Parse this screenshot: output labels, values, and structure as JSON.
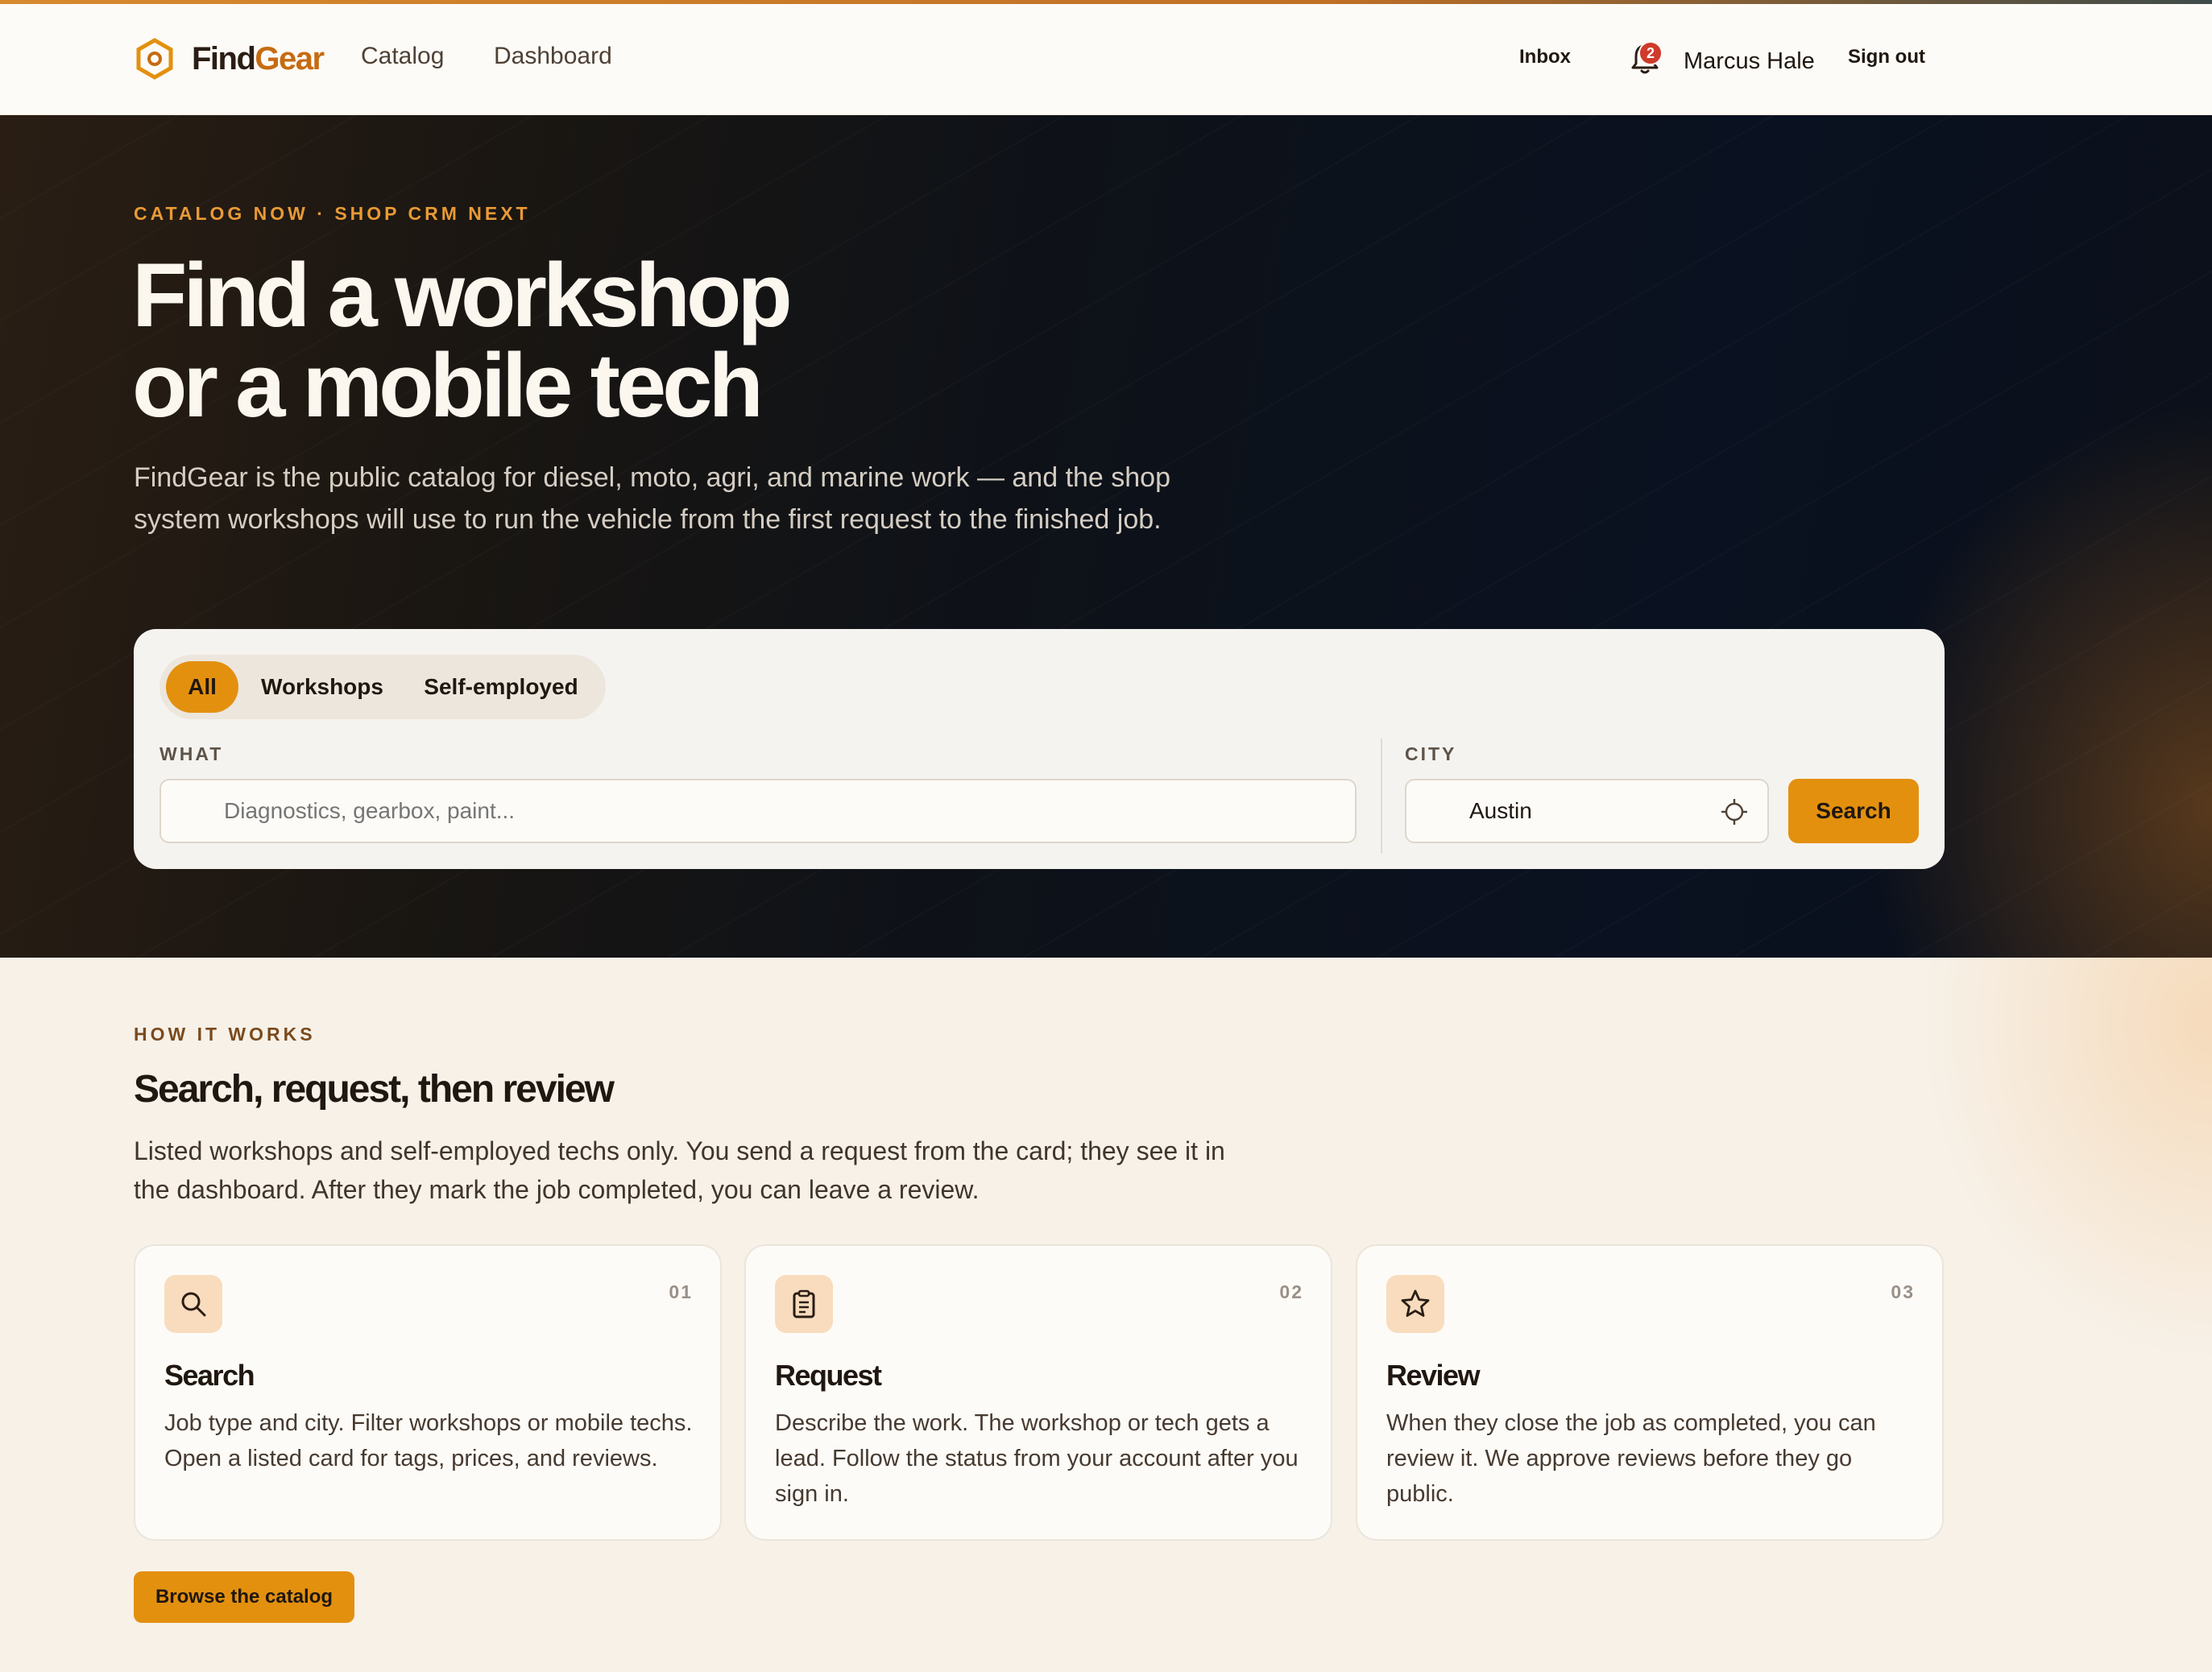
{
  "brand": {
    "name_part1": "Find",
    "name_part2": "Gear",
    "accent": "#e3900f",
    "brand_orange": "#c66b12"
  },
  "nav": {
    "links": [
      "Catalog",
      "Dashboard"
    ],
    "inbox": "Inbox",
    "notifications_count": "2",
    "user_name": "Marcus Hale",
    "sign_out": "Sign out"
  },
  "hero": {
    "eyebrow": "CATALOG NOW · SHOP CRM NEXT",
    "title_line1": "Find a workshop",
    "title_line2": "or a mobile tech",
    "description": "FindGear is the public catalog for diesel, moto, agri, and marine work — and the shop system workshops will use to run the vehicle from the first request to the finished job."
  },
  "search": {
    "tabs": [
      "All",
      "Workshops",
      "Self-employed"
    ],
    "active_tab": "All",
    "what_label": "WHAT",
    "what_placeholder": "Diagnostics, gearbox, paint...",
    "what_value": "",
    "city_label": "CITY",
    "city_value": "Austin",
    "button": "Search"
  },
  "how": {
    "eyebrow": "HOW IT WORKS",
    "title": "Search, request, then review",
    "description": "Listed workshops and self-employed techs only. You send a request from the card; they see it in the dashboard. After they mark the job completed, you can leave a review.",
    "cards": [
      {
        "num": "01",
        "icon": "search-icon",
        "title": "Search",
        "text": "Job type and city. Filter workshops or mobile techs. Open a listed card for tags, prices, and reviews."
      },
      {
        "num": "02",
        "icon": "clipboard-icon",
        "title": "Request",
        "text": "Describe the work. The workshop or tech gets a lead. Follow the status from your account after you sign in."
      },
      {
        "num": "03",
        "icon": "star-icon",
        "title": "Review",
        "text": "When they close the job as completed, you can review it. We approve reviews before they go public."
      }
    ],
    "cta": "Browse the catalog"
  }
}
